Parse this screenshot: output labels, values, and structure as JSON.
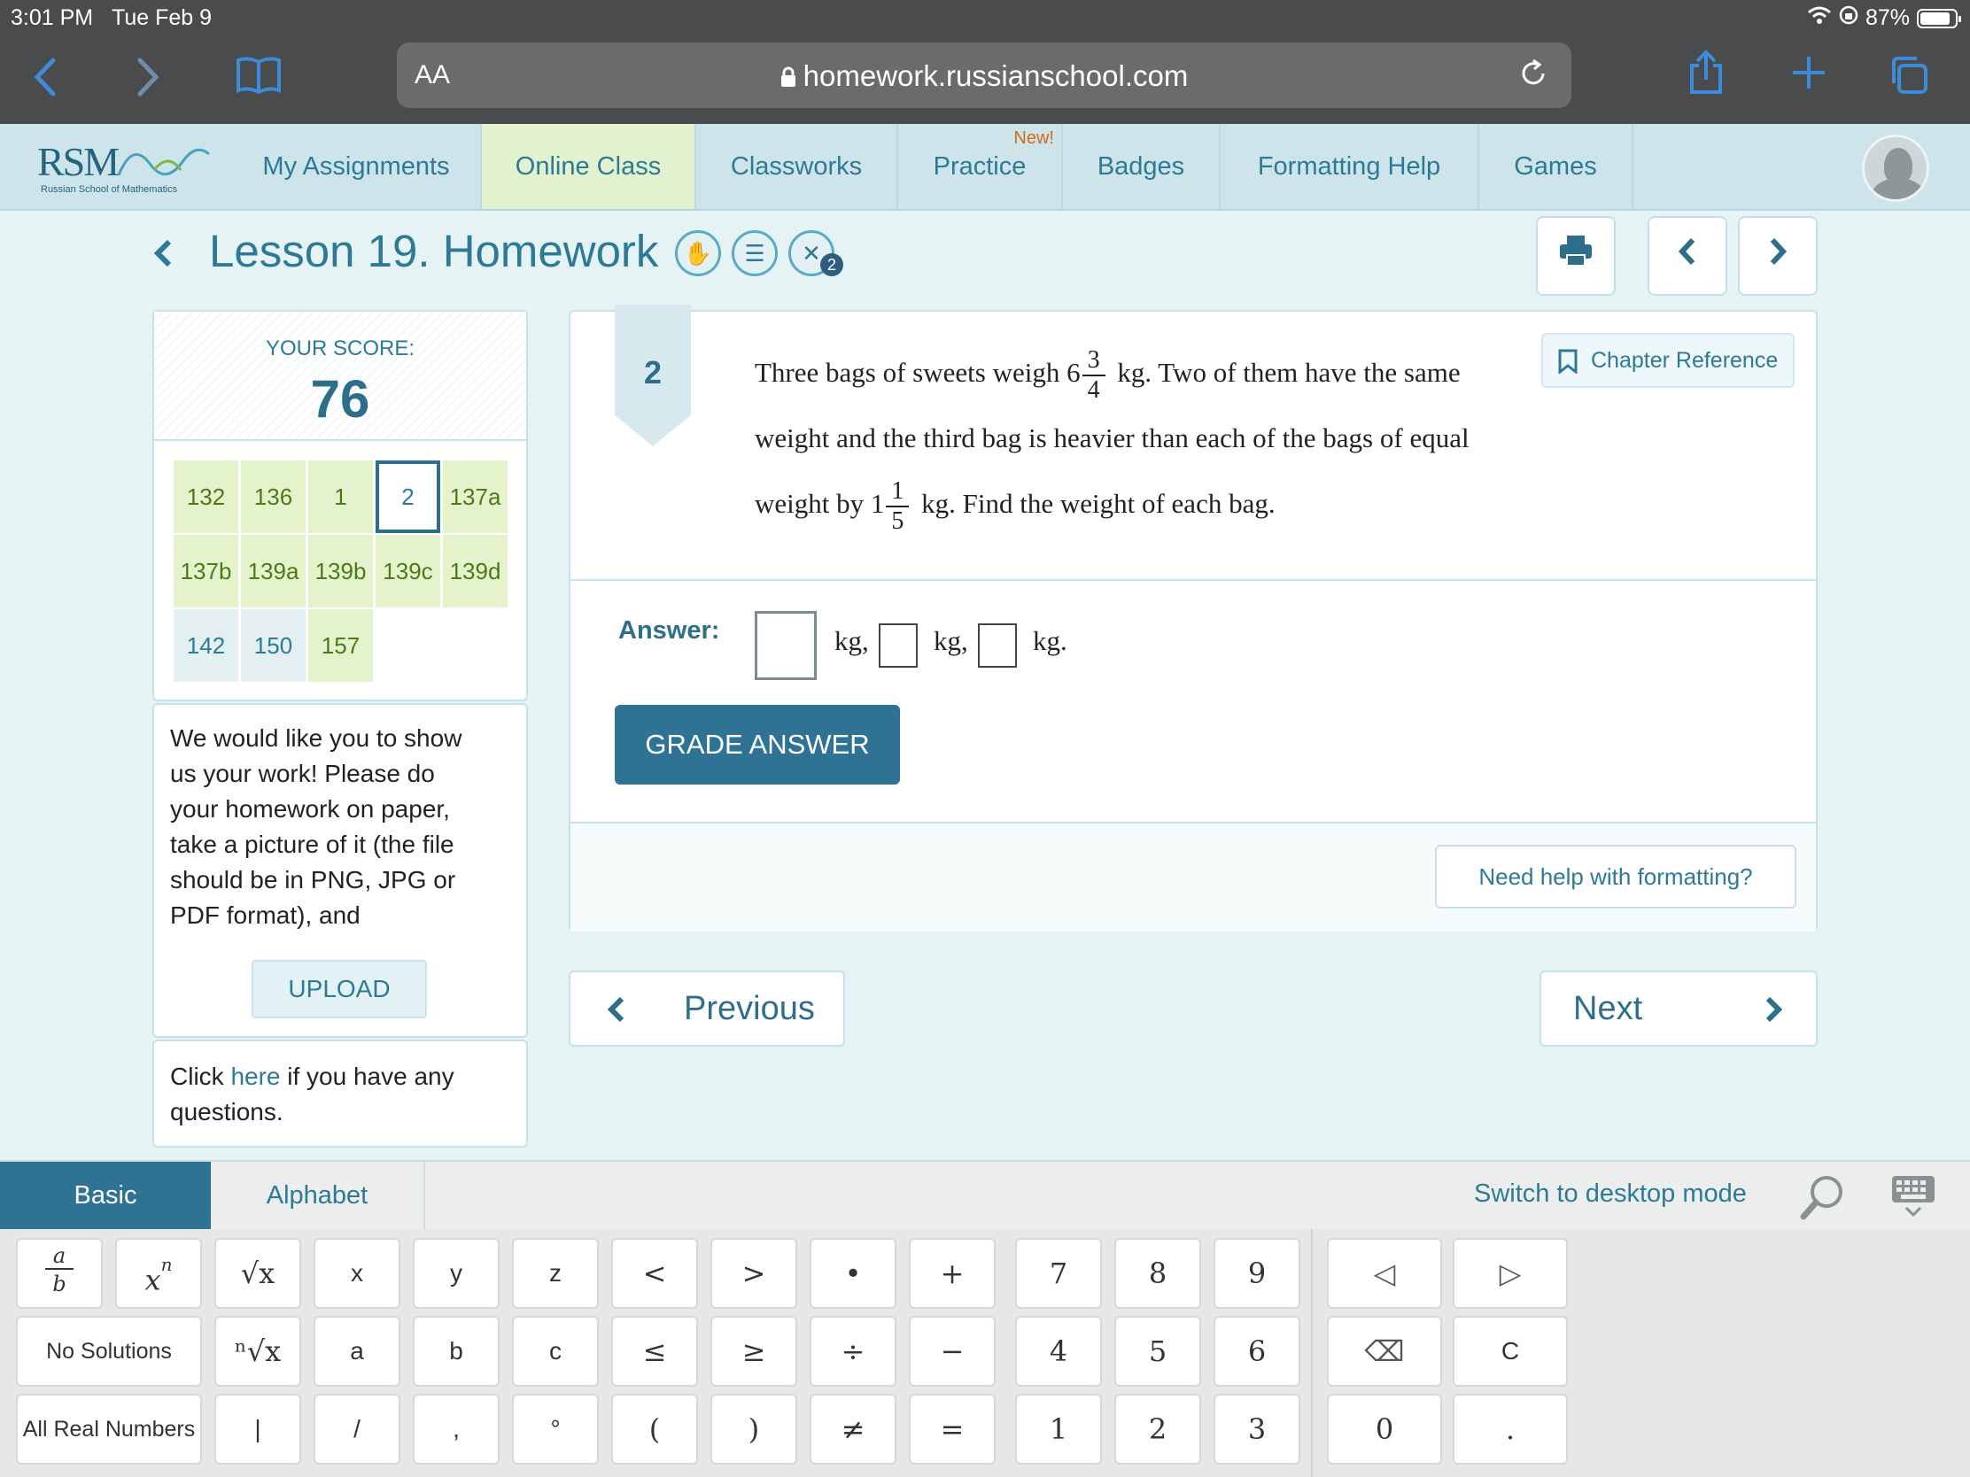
{
  "status": {
    "time": "3:01 PM",
    "date": "Tue Feb 9",
    "battery": "87%"
  },
  "browser": {
    "aa": "AA",
    "url": "homework.russianschool.com"
  },
  "logo": {
    "text": "RSM",
    "subtitle": "Russian School of Mathematics"
  },
  "nav": {
    "items": [
      {
        "label": "My Assignments"
      },
      {
        "label": "Online Class"
      },
      {
        "label": "Classworks"
      },
      {
        "label": "Practice",
        "badge": "New!"
      },
      {
        "label": "Badges"
      },
      {
        "label": "Formatting Help"
      },
      {
        "label": "Games"
      }
    ]
  },
  "lesson": {
    "title": "Lesson 19. Homework",
    "badge_count": "2"
  },
  "score": {
    "label": "YOUR SCORE:",
    "value": "76"
  },
  "questions": [
    "132",
    "136",
    "1",
    "2",
    "137a",
    "137b",
    "139a",
    "139b",
    "139c",
    "139d",
    "142",
    "150",
    "157"
  ],
  "work": {
    "text": "We would like you to show us your work! Please do your homework on paper, take a picture of it (the file should be in PNG, JPG or PDF format), and",
    "upload_label": "UPLOAD"
  },
  "questions_note": {
    "prefix": "Click",
    "link": "here",
    "suffix": "if you have any questions."
  },
  "problem": {
    "number": "2",
    "part1": "Three bags of sweets weigh 6",
    "frac1_num": "3",
    "frac1_den": "4",
    "part2": "kg. Two of them have the same weight and the third bag is heavier than each of the bags of equal weight by 1",
    "frac2_num": "1",
    "frac2_den": "5",
    "part3": "kg. Find the weight of each bag."
  },
  "chapter_ref": "Chapter Reference",
  "answer": {
    "label": "Answer:",
    "unit1": "kg,",
    "unit2": "kg,",
    "unit3": "kg."
  },
  "grade_label": "GRADE ANSWER",
  "help_label": "Need help with formatting?",
  "pager": {
    "prev": "Previous",
    "next": "Next"
  },
  "keyboard": {
    "tabs": [
      "Basic",
      "Alphabet"
    ],
    "switch_label": "Switch to desktop mode",
    "keys_row1": [
      "x",
      "y",
      "z",
      "<",
      ">",
      "•",
      "+",
      "7",
      "8",
      "9"
    ],
    "keys_row2": [
      "a",
      "b",
      "c",
      "≤",
      "≥",
      "÷",
      "−",
      "4",
      "5",
      "6"
    ],
    "keys_row3": [
      "|",
      "/",
      ",",
      "°",
      "(",
      ")",
      "≠",
      "=",
      "1",
      "2",
      "3"
    ],
    "frac_key": {
      "num": "a",
      "den": "b"
    },
    "pow_key": {
      "base": "x",
      "exp": "n"
    },
    "sqrt_key": "√x",
    "nroot_key": "ⁿ√x",
    "no_solutions": "No Solutions",
    "all_real": "All Real Numbers",
    "nav_left": "◁",
    "nav_right": "▷",
    "backspace": "⌫",
    "clear": "C",
    "zero": "0",
    "dot": "."
  }
}
